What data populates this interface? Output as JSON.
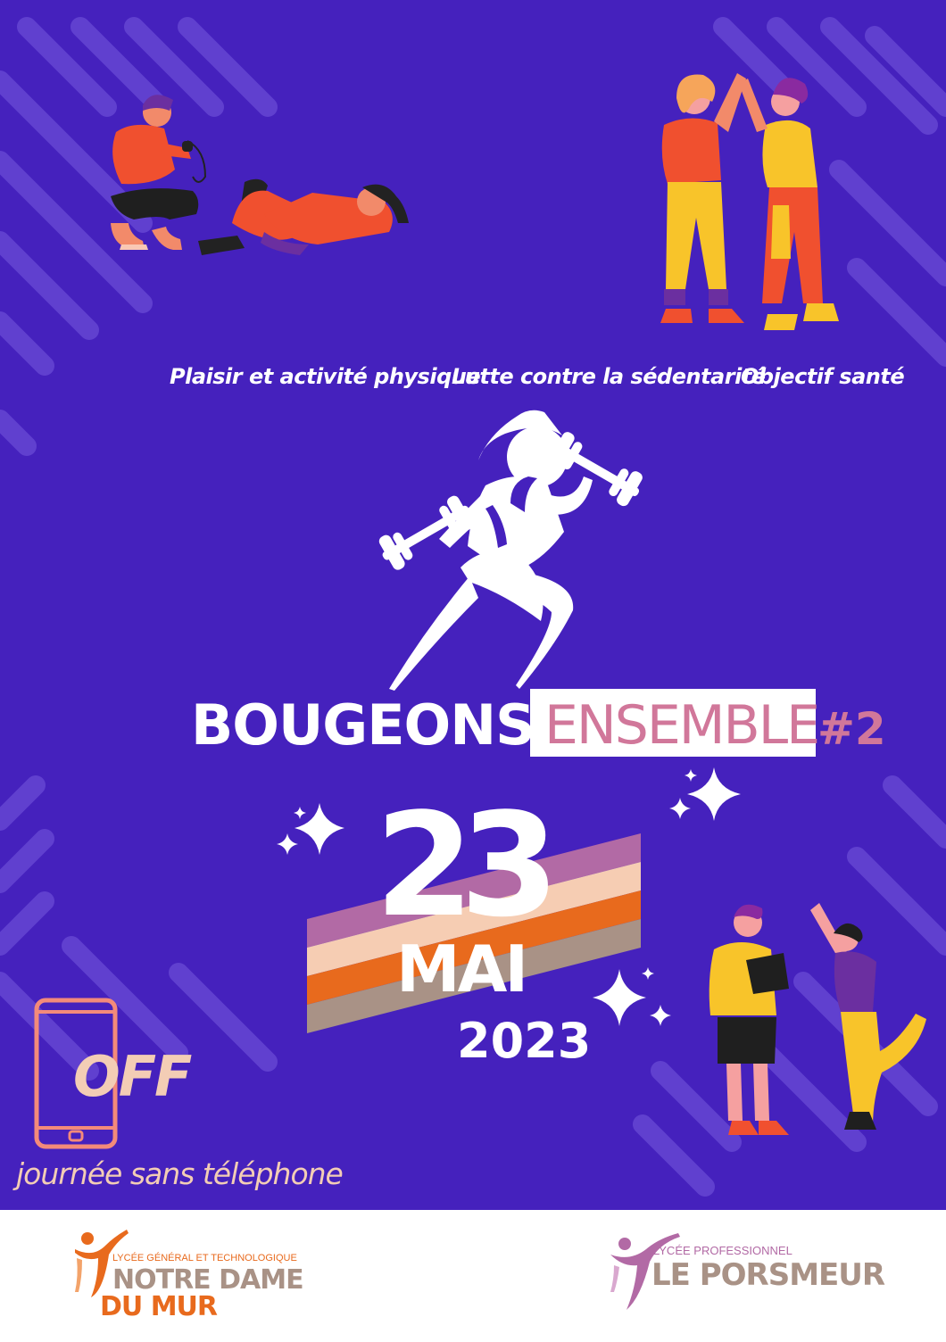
{
  "taglines": [
    "Plaisir et activité physique",
    "Lutte contre la sédentarité",
    "Objectif santé"
  ],
  "title": {
    "main": "BOUGEONS",
    "accent": "ENSEMBLE",
    "number": "#2"
  },
  "date": {
    "day": "23",
    "month": "MAI",
    "year": "2023"
  },
  "phone_notice": {
    "off": "OFF",
    "text": "journée sans téléphone"
  },
  "logos": {
    "left": {
      "subtitle": "LYCÉE GÉNÉRAL ET TECHNOLOGIQUE",
      "line1": "NOTRE DAME",
      "line2": "DU MUR"
    },
    "right": {
      "subtitle": "LYCÉE PROFESSIONNEL",
      "name": "LE PORSMEUR"
    }
  },
  "colors": {
    "background": "#4521bd",
    "accent_pink": "#d1779a",
    "peach": "#f3cdb5",
    "orange": "#e86a1d",
    "mauve": "#b26aa5"
  }
}
